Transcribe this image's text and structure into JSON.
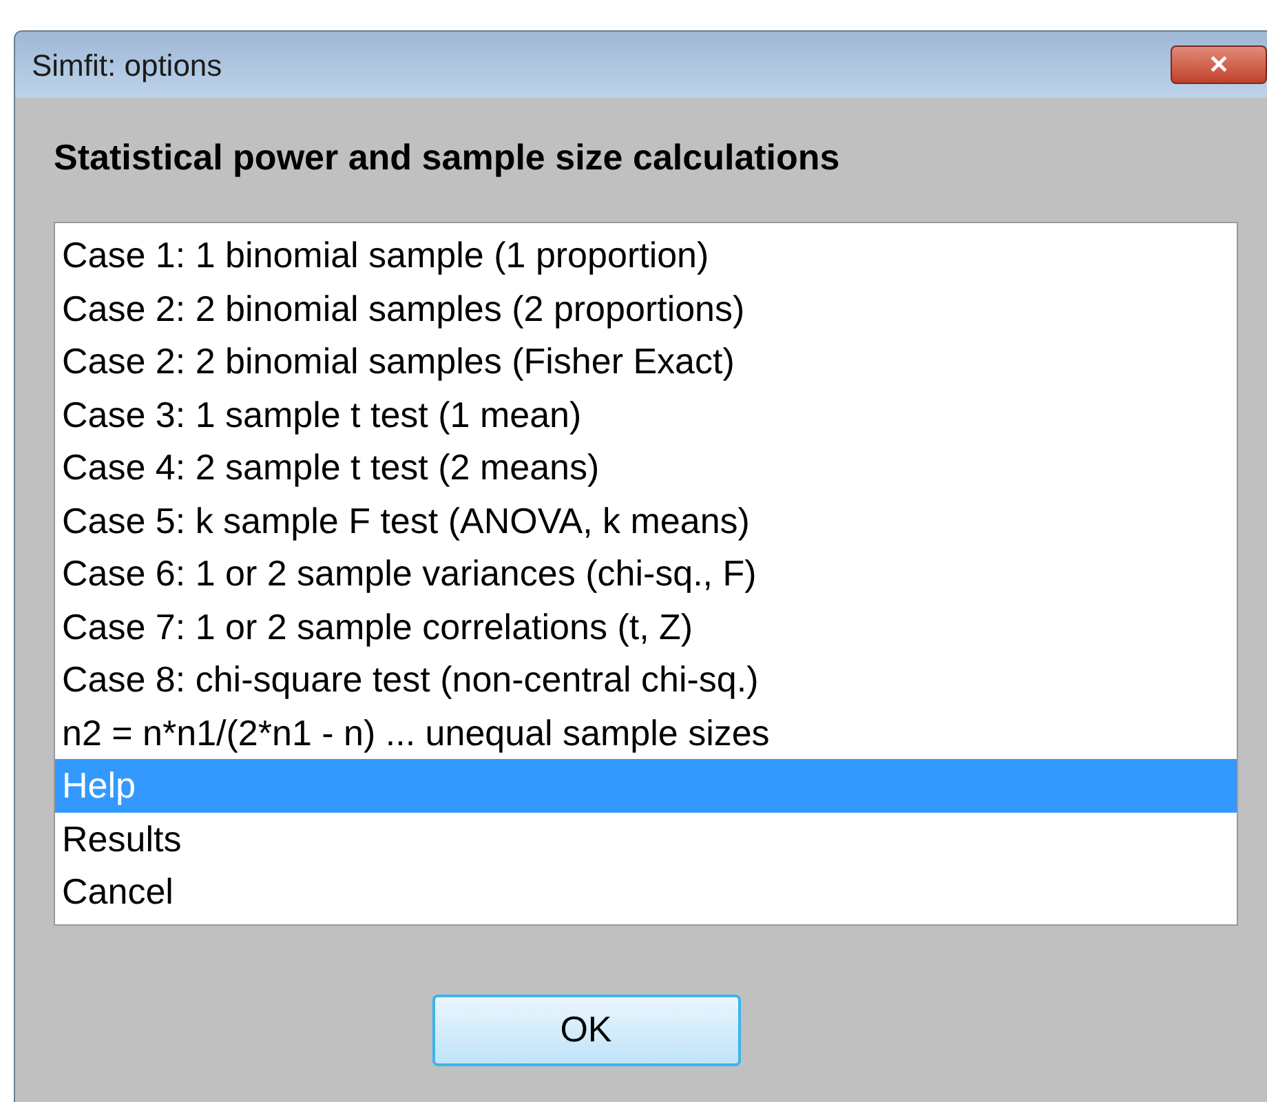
{
  "window": {
    "title": "Simfit: options",
    "close_label": "✕"
  },
  "heading": "Statistical power and sample size calculations",
  "list": {
    "items": [
      {
        "label": "Case 1: 1 binomial sample (1 proportion)",
        "selected": false
      },
      {
        "label": "Case 2: 2 binomial samples (2 proportions)",
        "selected": false
      },
      {
        "label": "Case 2: 2 binomial samples (Fisher Exact)",
        "selected": false
      },
      {
        "label": "Case 3: 1 sample t test (1 mean)",
        "selected": false
      },
      {
        "label": "Case 4: 2 sample t test (2 means)",
        "selected": false
      },
      {
        "label": "Case 5: k sample F test (ANOVA, k means)",
        "selected": false
      },
      {
        "label": "Case 6: 1 or 2 sample variances (chi-sq., F)",
        "selected": false
      },
      {
        "label": "Case 7: 1 or 2 sample correlations (t, Z)",
        "selected": false
      },
      {
        "label": "Case 8: chi-square test (non-central chi-sq.)",
        "selected": false
      },
      {
        "label": "n2 = n*n1/(2*n1 - n) ... unequal sample sizes",
        "selected": false
      },
      {
        "label": "Help",
        "selected": true
      },
      {
        "label": "Results",
        "selected": false
      },
      {
        "label": "Cancel",
        "selected": false
      }
    ]
  },
  "buttons": [
    "OK"
  ]
}
